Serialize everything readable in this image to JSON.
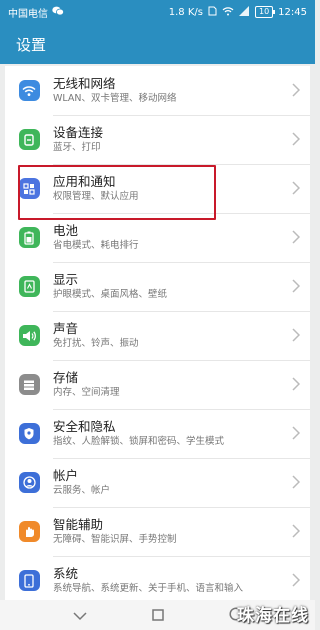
{
  "status": {
    "carrier": "中国电信",
    "speed": "1.8 K/s",
    "battery": "10",
    "time": "12:45"
  },
  "appbar": {
    "title": "设置"
  },
  "settings": [
    {
      "title": "无线和网络",
      "sub": "WLAN、双卡管理、移动网络",
      "color": "#3d8be0",
      "icon": "wifi-icon"
    },
    {
      "title": "设备连接",
      "sub": "蓝牙、打印",
      "color": "#3fb65a",
      "icon": "device-connect-icon"
    },
    {
      "title": "应用和通知",
      "sub": "权限管理、默认应用",
      "color": "#4c74e0",
      "icon": "apps-grid-icon"
    },
    {
      "title": "电池",
      "sub": "省电模式、耗电排行",
      "color": "#3fb65a",
      "icon": "battery-icon"
    },
    {
      "title": "显示",
      "sub": "护眼模式、桌面风格、壁纸",
      "color": "#3fb65a",
      "icon": "display-icon"
    },
    {
      "title": "声音",
      "sub": "免打扰、铃声、振动",
      "color": "#3fb65a",
      "icon": "sound-icon"
    },
    {
      "title": "存储",
      "sub": "内存、空间清理",
      "color": "#8c8c8c",
      "icon": "storage-icon"
    },
    {
      "title": "安全和隐私",
      "sub": "指纹、人脸解锁、锁屏和密码、学生模式",
      "color": "#3d6fd8",
      "icon": "shield-icon"
    },
    {
      "title": "帐户",
      "sub": "云服务、帐户",
      "color": "#3d6fd8",
      "icon": "account-icon"
    },
    {
      "title": "智能辅助",
      "sub": "无障碍、智能识屏、手势控制",
      "color": "#f08a2a",
      "icon": "hand-icon"
    },
    {
      "title": "系统",
      "sub": "系统导航、系统更新、关于手机、语言和输入",
      "color": "#3d6fd8",
      "icon": "phone-icon"
    }
  ],
  "watermark": "珠海在线"
}
